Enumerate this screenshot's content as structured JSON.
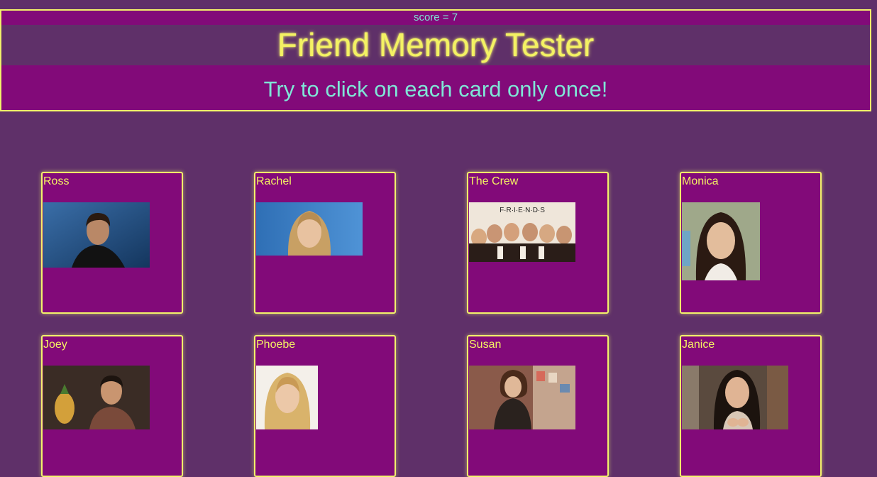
{
  "score": {
    "label": "score = 7"
  },
  "header": {
    "title": "Friend Memory Tester",
    "subtitle": "Try to click on each card only once!"
  },
  "colors": {
    "background": "#5f3069",
    "panel": "#820a79",
    "accent_yellow": "#f2f26a",
    "accent_teal": "#7fe6d6"
  },
  "cards": [
    {
      "name": "Ross",
      "photo": "photo-ross"
    },
    {
      "name": "Rachel",
      "photo": "photo-rachel"
    },
    {
      "name": "The Crew",
      "photo": "photo-the-crew"
    },
    {
      "name": "Monica",
      "photo": "photo-monica"
    },
    {
      "name": "Joey",
      "photo": "photo-joey"
    },
    {
      "name": "Phoebe",
      "photo": "photo-phoebe"
    },
    {
      "name": "Susan",
      "photo": "photo-susan"
    },
    {
      "name": "Janice",
      "photo": "photo-janice"
    }
  ]
}
